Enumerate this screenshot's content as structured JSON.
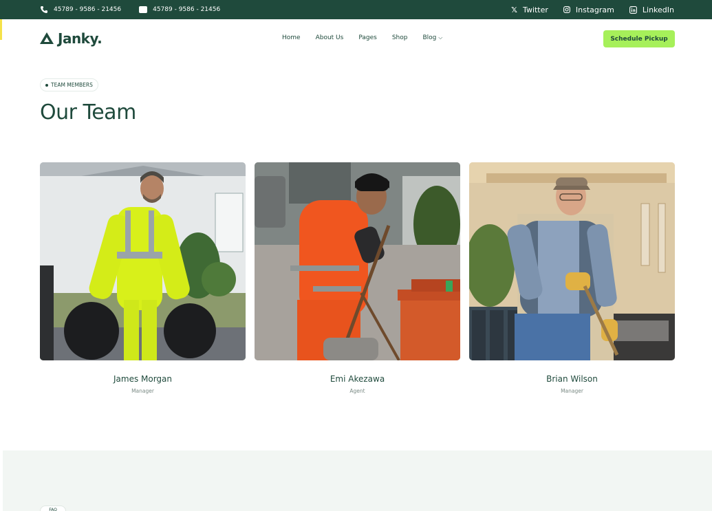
{
  "topbar": {
    "phone": "45789 - 9586 - 21456",
    "message": "45789 - 9586 - 21456",
    "social": [
      "Twitter",
      "Instagram",
      "LinkedIn"
    ]
  },
  "header": {
    "logo": "Janky.",
    "nav": [
      "Home",
      "About Us",
      "Pages",
      "Shop",
      "Blog"
    ],
    "cta": "Schedule Pickup"
  },
  "section": {
    "badge": "TEAM MEMBERS",
    "title": "Our Team"
  },
  "team": [
    {
      "name": "James Morgan",
      "role": "Manager"
    },
    {
      "name": "Emi Akezawa",
      "role": "Agent"
    },
    {
      "name": "Brian Wilson",
      "role": "Manager"
    }
  ],
  "footer_band": {
    "pill": "FAQ"
  }
}
